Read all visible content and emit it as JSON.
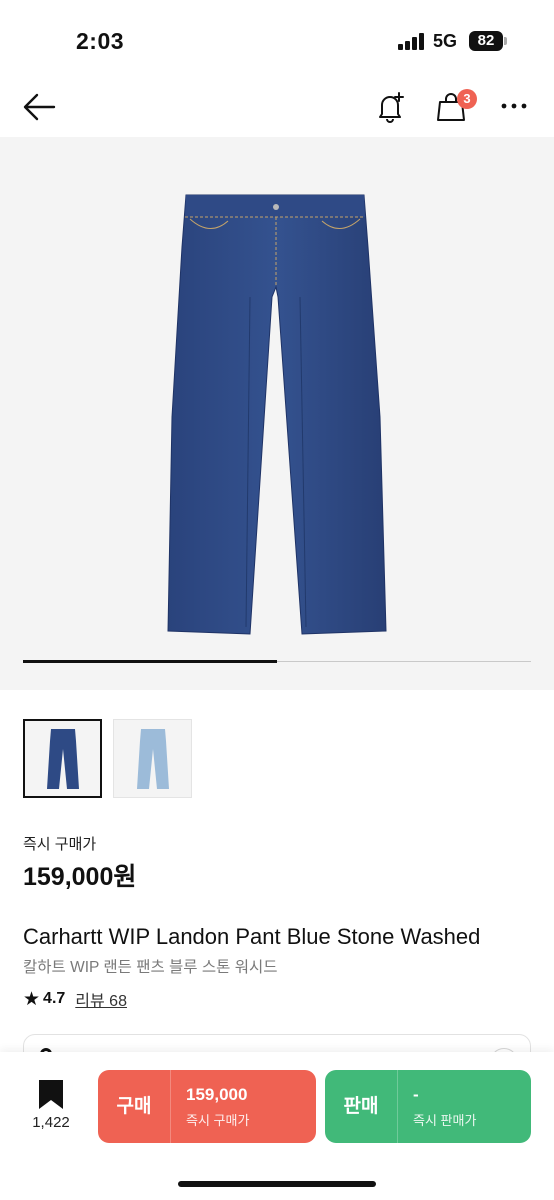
{
  "status_bar": {
    "time": "2:03",
    "network": "5G",
    "battery": "82"
  },
  "nav": {
    "cart_badge": "3"
  },
  "hero": {
    "image_index": 1,
    "image_count": 2
  },
  "colors": {
    "buy": "#ef6253",
    "sell": "#41b979",
    "denim_dark": "#2e4a85",
    "denim_light": "#9cbbd9"
  },
  "price": {
    "label": "즉시 구매가",
    "value": "159,000원"
  },
  "product": {
    "name_en": "Carhartt WIP Landon Pant Blue Stone Washed",
    "name_ko": "칼하트 WIP 랜든 팬츠 블루 스톤 워시드",
    "rating": "4.7",
    "review_text": "리뷰 68"
  },
  "bottom": {
    "wish_count": "1,422",
    "buy": {
      "label": "구매",
      "price": "159,000",
      "sub": "즉시 구매가"
    },
    "sell": {
      "label": "판매",
      "price": "-",
      "sub": "즉시 판매가"
    }
  },
  "icons": [
    "back-arrow-icon",
    "bell-plus-icon",
    "shopping-bag-icon",
    "more-icon",
    "bookmark-icon",
    "star-icon"
  ]
}
